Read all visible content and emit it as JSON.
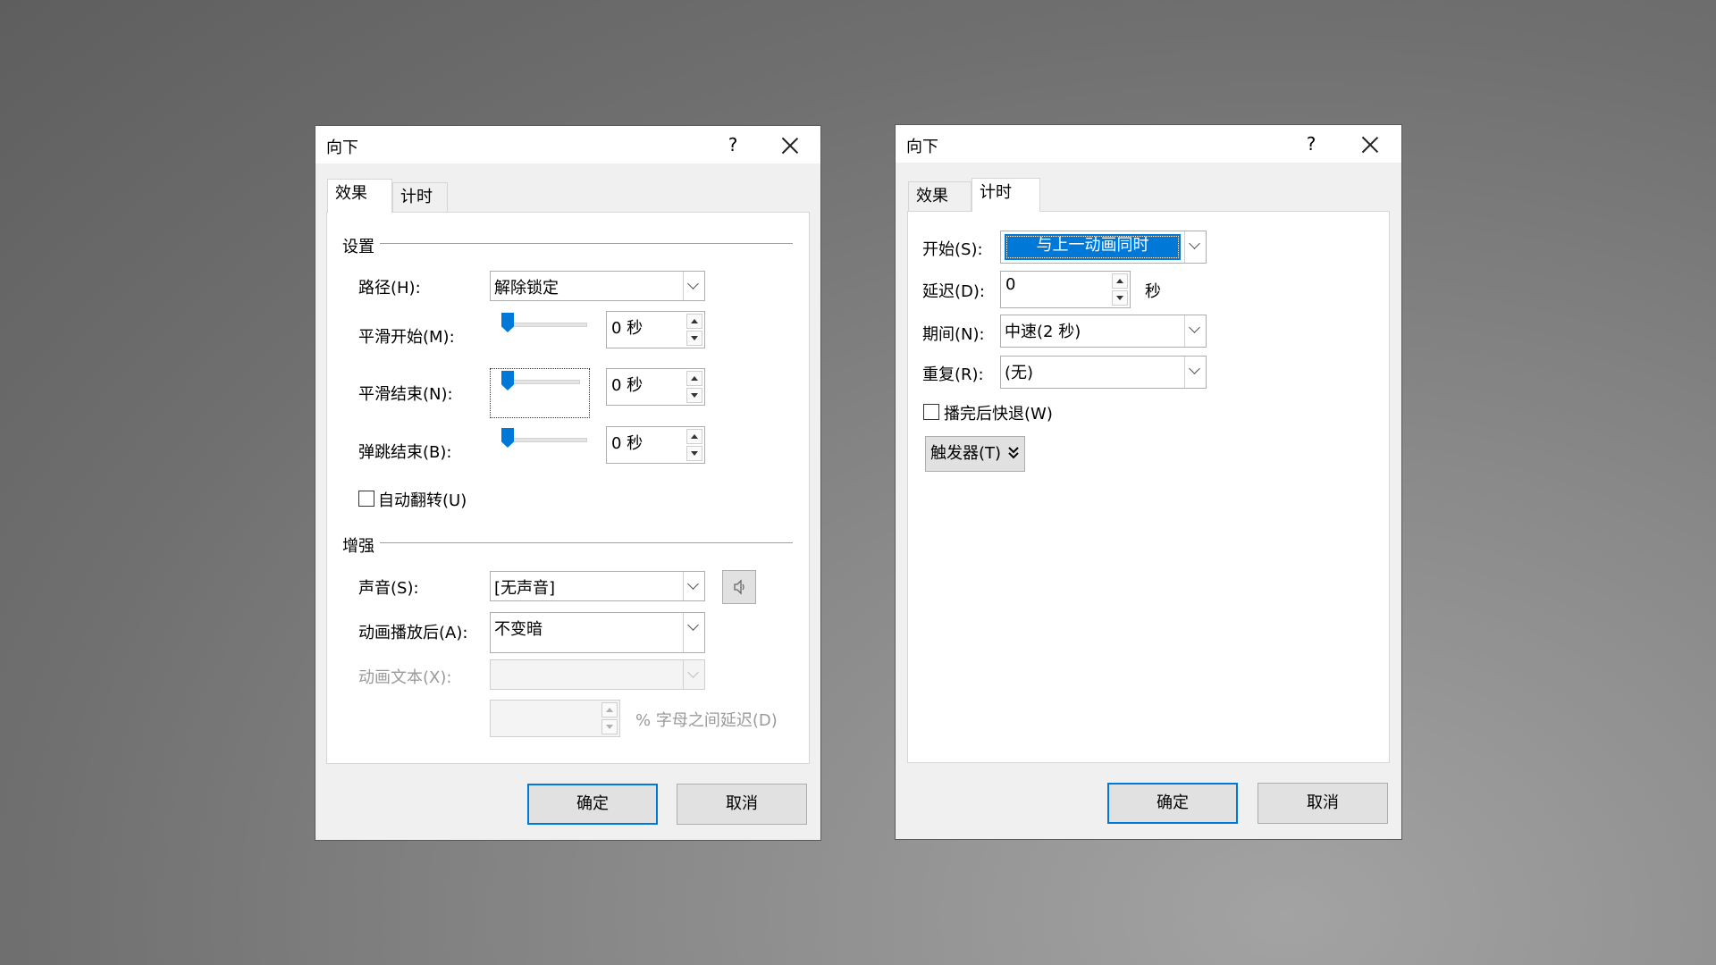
{
  "dialog1": {
    "title": "向下",
    "help": "?",
    "tabs": [
      {
        "label": "效果"
      },
      {
        "label": "计时"
      }
    ],
    "settings_section": "设置",
    "path_label": "路径(H):",
    "path_value": "解除锁定",
    "smooth_start_label": "平滑开始(M):",
    "smooth_start_value": "0 秒",
    "smooth_end_label": "平滑结束(N):",
    "smooth_end_value": "0 秒",
    "bounce_end_label": "弹跳结束(B):",
    "bounce_end_value": "0 秒",
    "auto_reverse_label": "自动翻转(U)",
    "enhance_section": "增强",
    "sound_label": "声音(S):",
    "sound_value": "[无声音]",
    "after_anim_label": "动画播放后(A):",
    "after_anim_value": "不变暗",
    "anim_text_label": "动画文本(X):",
    "anim_text_value": "",
    "delay_between_letters_value": "",
    "delay_between_letters_label": "% 字母之间延迟(D)",
    "ok_label": "确定",
    "cancel_label": "取消"
  },
  "dialog2": {
    "title": "向下",
    "help": "?",
    "tabs": [
      {
        "label": "效果"
      },
      {
        "label": "计时"
      }
    ],
    "start_label": "开始(S):",
    "start_value": "与上一动画同时",
    "delay_label": "延迟(D):",
    "delay_value": "0",
    "delay_unit": "秒",
    "duration_label": "期间(N):",
    "duration_value": "中速(2 秒)",
    "repeat_label": "重复(R):",
    "repeat_value": "(无)",
    "rewind_label": "播完后快退(W)",
    "triggers_label": "触发器(T)",
    "ok_label": "确定",
    "cancel_label": "取消"
  },
  "colors": {
    "accent": "#0078d7",
    "dialog_bg": "#f0f0f0",
    "panel_bg": "#ffffff"
  }
}
